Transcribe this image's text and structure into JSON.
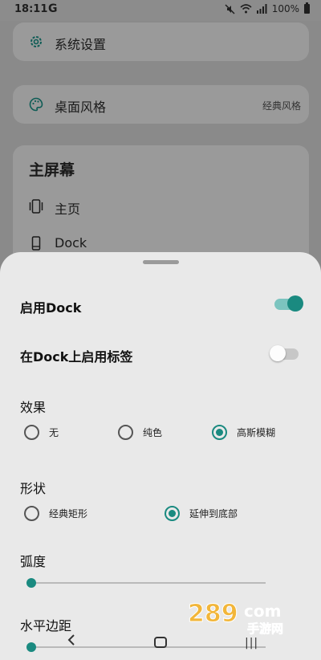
{
  "status_bar": {
    "time": "18:11",
    "carrier_icon": "G",
    "battery": "100%"
  },
  "background": {
    "system_settings": {
      "label": "系统设置",
      "icon": "gear-icon"
    },
    "desktop_style": {
      "label": "桌面风格",
      "value": "经典风格",
      "icon": "palette-icon"
    },
    "home_screen": {
      "title": "主屏幕",
      "items": [
        {
          "label": "主页",
          "icon": "phone-pages-icon"
        },
        {
          "label": "Dock",
          "icon": "phone-icon"
        }
      ]
    }
  },
  "sheet": {
    "enable_dock": {
      "label": "启用Dock",
      "checked": true
    },
    "dock_labels": {
      "label": "在Dock上启用标签",
      "checked": false
    },
    "effect": {
      "title": "效果",
      "options": [
        {
          "label": "无",
          "selected": false
        },
        {
          "label": "纯色",
          "selected": false
        },
        {
          "label": "高斯模糊",
          "selected": true
        }
      ]
    },
    "shape": {
      "title": "形状",
      "options": [
        {
          "label": "经典矩形",
          "selected": false
        },
        {
          "label": "延伸到底部",
          "selected": true
        }
      ]
    },
    "radius": {
      "title": "弧度",
      "value": 0
    },
    "h_margin": {
      "title": "水平边距",
      "value": 0
    }
  },
  "watermark": {
    "number": "289",
    "suffix": "com",
    "sub": "手游网"
  },
  "colors": {
    "accent": "#1a8a80",
    "sheet_bg": "#e9e9e9",
    "scrim": "#8a8a8a"
  }
}
